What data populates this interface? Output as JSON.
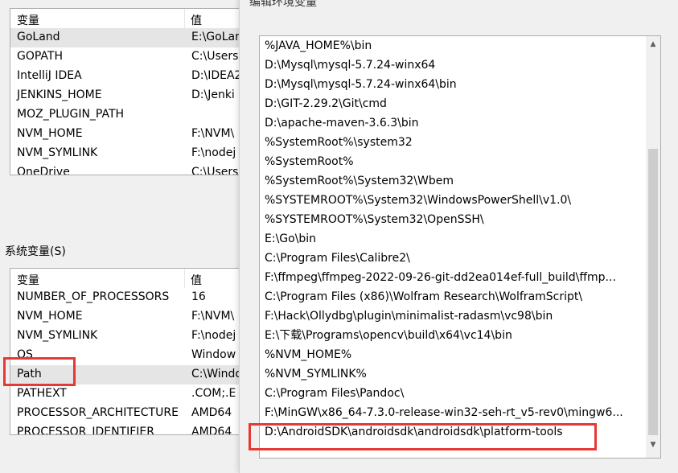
{
  "user_vars": {
    "header": {
      "name": "变量",
      "value": "值"
    },
    "rows": [
      {
        "name": "GoLand",
        "value": "E:\\GoLan"
      },
      {
        "name": "GOPATH",
        "value": "C:\\Users"
      },
      {
        "name": "IntelliJ IDEA",
        "value": "D:\\IDEA2"
      },
      {
        "name": "JENKINS_HOME",
        "value": "D:\\Jenki"
      },
      {
        "name": "MOZ_PLUGIN_PATH",
        "value": ""
      },
      {
        "name": "NVM_HOME",
        "value": "F:\\NVM\\"
      },
      {
        "name": "NVM_SYMLINK",
        "value": "F:\\nodej"
      },
      {
        "name": "OneDrive",
        "value": "C:\\Users"
      }
    ]
  },
  "system_vars": {
    "label": "系统变量(S)",
    "header": {
      "name": "变量",
      "value": "值"
    },
    "rows": [
      {
        "name": "NUMBER_OF_PROCESSORS",
        "value": "16"
      },
      {
        "name": "NVM_HOME",
        "value": "F:\\NVM\\"
      },
      {
        "name": "NVM_SYMLINK",
        "value": "F:\\nodej"
      },
      {
        "name": "OS",
        "value": "Window"
      },
      {
        "name": "Path",
        "value": "C:\\Windo"
      },
      {
        "name": "PATHEXT",
        "value": ".COM;.E"
      },
      {
        "name": "PROCESSOR_ARCHITECTURE",
        "value": "AMD64"
      },
      {
        "name": "PROCESSOR_IDENTIFIER",
        "value": "AMD64"
      }
    ]
  },
  "edit_dialog": {
    "title": "编辑环境变量",
    "entries": [
      "%JAVA_HOME%\\bin",
      "D:\\Mysql\\mysql-5.7.24-winx64",
      "D:\\Mysql\\mysql-5.7.24-winx64\\bin",
      "D:\\GIT-2.29.2\\Git\\cmd",
      "D:\\apache-maven-3.6.3\\bin",
      "%SystemRoot%\\system32",
      "%SystemRoot%",
      "%SystemRoot%\\System32\\Wbem",
      "%SYSTEMROOT%\\System32\\WindowsPowerShell\\v1.0\\",
      "%SYSTEMROOT%\\System32\\OpenSSH\\",
      "E:\\Go\\bin",
      "C:\\Program Files\\Calibre2\\",
      "F:\\ffmpeg\\ffmpeg-2022-09-26-git-dd2ea014ef-full_build\\ffmp...",
      "C:\\Program Files (x86)\\Wolfram Research\\WolframScript\\",
      "F:\\Hack\\Ollydbg\\plugin\\minimalist-radasm\\vc98\\bin",
      "E:\\下载\\Programs\\opencv\\build\\x64\\vc14\\bin",
      "%NVM_HOME%",
      "%NVM_SYMLINK%",
      "C:\\Program Files\\Pandoc\\",
      "F:\\MinGW\\x86_64-7.3.0-release-win32-seh-rt_v5-rev0\\mingw6...",
      "D:\\AndroidSDK\\androidsdk\\androidsdk\\platform-tools"
    ]
  },
  "colors": {
    "highlight_box": "#e53935",
    "selected_row": "#e5e5e5"
  },
  "icons": {
    "scroll_up": "chevron-up-icon",
    "scroll_down": "chevron-down-icon"
  }
}
